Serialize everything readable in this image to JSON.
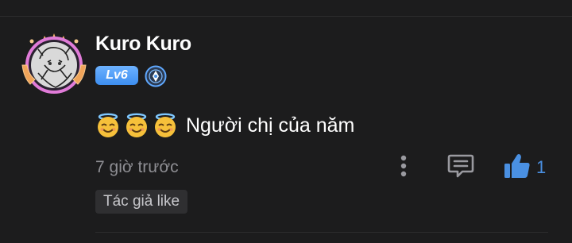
{
  "comment": {
    "username": "Kuro Kuro",
    "level": "Lv6",
    "text": "Người chị của năm",
    "emojis": [
      "smiling-face-with-halo",
      "smiling-face-with-halo",
      "smiling-face-with-halo"
    ],
    "timestamp": "7 giờ trước",
    "like_count": "1",
    "author_like_tag": "Tác giả like",
    "icons": {
      "avatar": "avatar",
      "verify": "verified-badge-icon",
      "more": "more-vertical-icon",
      "reply": "reply-comment-icon",
      "like": "thumbs-up-icon"
    }
  },
  "colors": {
    "background": "#1c1c1d",
    "accent": "#4a90e2",
    "level_badge": "#4a9af5",
    "muted_text": "#8e8e93",
    "tag_bg": "#2f2f31"
  }
}
